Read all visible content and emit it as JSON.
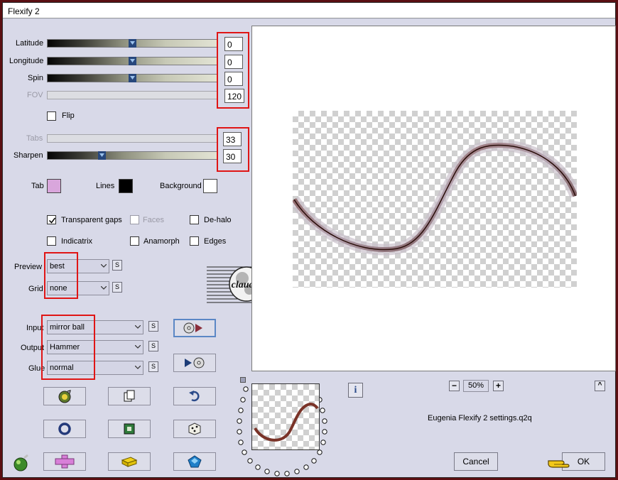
{
  "window": {
    "title": "Flexify 2"
  },
  "sliders": [
    {
      "label": "Latitude",
      "value": "0",
      "level": 0.5,
      "enabled": true
    },
    {
      "label": "Longitude",
      "value": "0",
      "level": 0.5,
      "enabled": true
    },
    {
      "label": "Spin",
      "value": "0",
      "level": 0.5,
      "enabled": true
    },
    {
      "label": "FOV",
      "value": "120",
      "level": 0,
      "enabled": false
    }
  ],
  "flip": {
    "label": "Flip",
    "checked": false
  },
  "sliders2": [
    {
      "label": "Tabs",
      "value": "33",
      "enabled": false
    },
    {
      "label": "Sharpen",
      "value": "30",
      "level": 0.3,
      "enabled": true
    }
  ],
  "colors": {
    "tab": {
      "label": "Tab",
      "color": "#d9a6dc"
    },
    "lines": {
      "label": "Lines",
      "color": "#000000"
    },
    "background": {
      "label": "Background",
      "color": "#ffffff"
    }
  },
  "options": {
    "transparent_gaps": {
      "label": "Transparent gaps",
      "checked": true
    },
    "faces": {
      "label": "Faces",
      "checked": false,
      "enabled": false
    },
    "de_halo": {
      "label": "De-halo",
      "checked": false
    },
    "indicatrix": {
      "label": "Indicatrix",
      "checked": false
    },
    "anamorph": {
      "label": "Anamorph",
      "checked": false
    },
    "edges": {
      "label": "Edges",
      "checked": false
    }
  },
  "preview_select": {
    "label": "Preview",
    "value": "best"
  },
  "grid_select": {
    "label": "Grid",
    "value": "none"
  },
  "input_select": {
    "label": "Input",
    "value": "mirror ball"
  },
  "output_select": {
    "label": "Output",
    "value": "Hammer"
  },
  "glue_select": {
    "label": "Glue",
    "value": "normal"
  },
  "s_button_label": "S",
  "watermark": {
    "text": "claudia"
  },
  "zoom": {
    "value": "50%",
    "minus": "−",
    "plus": "+"
  },
  "settings_file": "Eugenia Flexify 2 settings.q2q",
  "buttons": {
    "cancel": "Cancel",
    "ok": "OK",
    "info": "i",
    "collapse": "^"
  },
  "accent": {
    "highlight": "#e01515",
    "selected_border": "#5b87c5"
  }
}
